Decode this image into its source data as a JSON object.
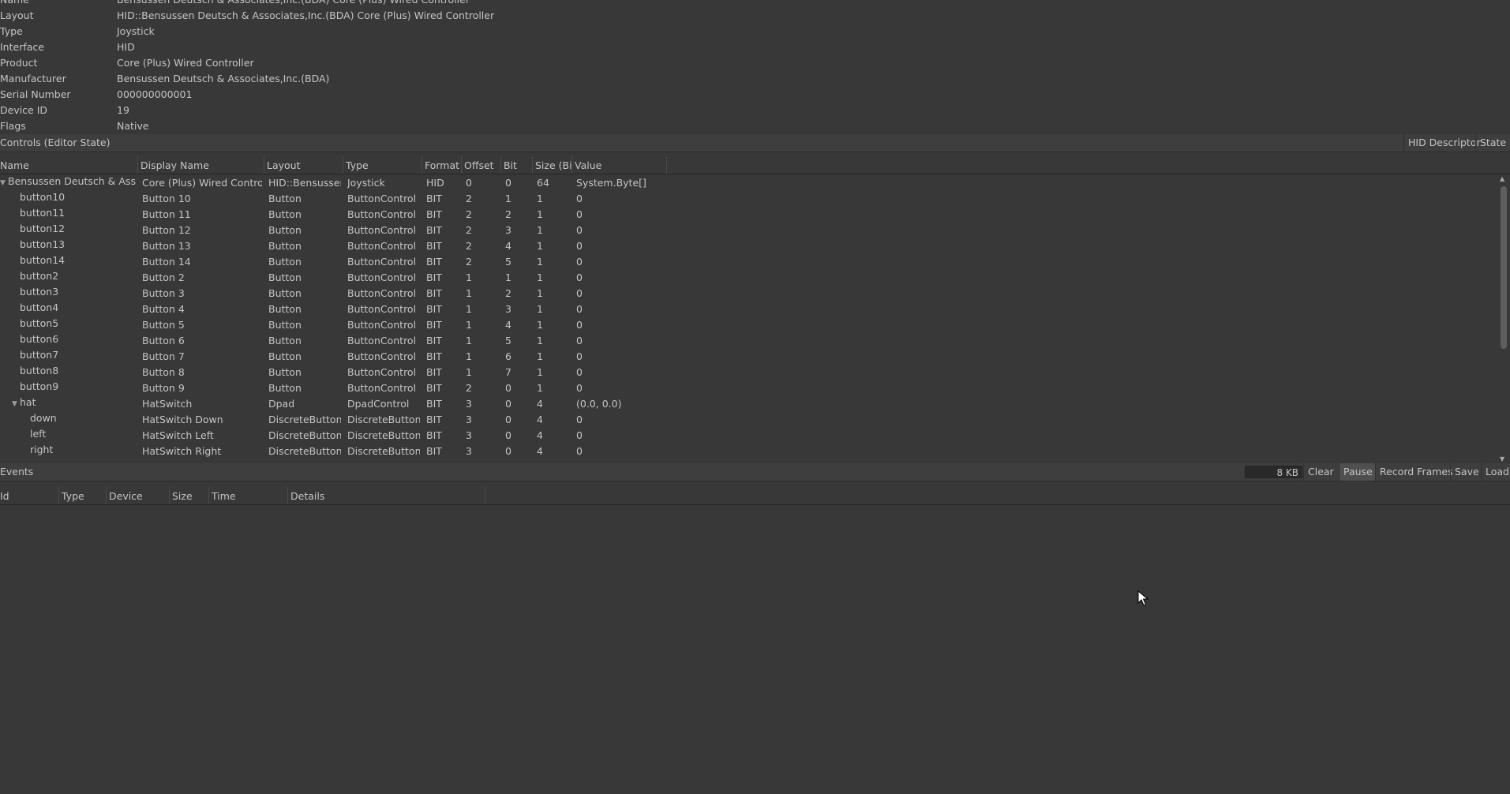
{
  "properties": [
    {
      "key": "Name",
      "value": "Bensussen Deutsch & Associates,Inc.(BDA) Core (Plus) Wired Controller"
    },
    {
      "key": "Layout",
      "value": "HID::Bensussen Deutsch & Associates,Inc.(BDA) Core (Plus) Wired Controller"
    },
    {
      "key": "Type",
      "value": "Joystick"
    },
    {
      "key": "Interface",
      "value": "HID"
    },
    {
      "key": "Product",
      "value": "Core (Plus) Wired Controller"
    },
    {
      "key": "Manufacturer",
      "value": "Bensussen Deutsch & Associates,Inc.(BDA)"
    },
    {
      "key": "Serial Number",
      "value": "000000000001"
    },
    {
      "key": "Device ID",
      "value": "19"
    },
    {
      "key": "Flags",
      "value": "Native"
    }
  ],
  "controls": {
    "title": "Controls (Editor State)",
    "buttons": {
      "hid_descriptor": "HID Descriptor",
      "state": "State"
    },
    "columns": [
      "Name",
      "Display Name",
      "Layout",
      "Type",
      "Format",
      "Offset",
      "Bit",
      "Size (Bi",
      "Value"
    ],
    "rows": [
      {
        "name": "Bensussen Deutsch & Associ",
        "display": "Core (Plus) Wired Controlle",
        "layout": "HID::Bensussen",
        "type": "Joystick",
        "format": "HID",
        "offset": "0",
        "bit": "0",
        "size": "64",
        "value": "System.Byte[]"
      },
      {
        "name": "button10",
        "display": "Button 10",
        "layout": "Button",
        "type": "ButtonControl",
        "format": "BIT",
        "offset": "2",
        "bit": "1",
        "size": "1",
        "value": "0"
      },
      {
        "name": "button11",
        "display": "Button 11",
        "layout": "Button",
        "type": "ButtonControl",
        "format": "BIT",
        "offset": "2",
        "bit": "2",
        "size": "1",
        "value": "0"
      },
      {
        "name": "button12",
        "display": "Button 12",
        "layout": "Button",
        "type": "ButtonControl",
        "format": "BIT",
        "offset": "2",
        "bit": "3",
        "size": "1",
        "value": "0"
      },
      {
        "name": "button13",
        "display": "Button 13",
        "layout": "Button",
        "type": "ButtonControl",
        "format": "BIT",
        "offset": "2",
        "bit": "4",
        "size": "1",
        "value": "0"
      },
      {
        "name": "button14",
        "display": "Button 14",
        "layout": "Button",
        "type": "ButtonControl",
        "format": "BIT",
        "offset": "2",
        "bit": "5",
        "size": "1",
        "value": "0"
      },
      {
        "name": "button2",
        "display": "Button 2",
        "layout": "Button",
        "type": "ButtonControl",
        "format": "BIT",
        "offset": "1",
        "bit": "1",
        "size": "1",
        "value": "0"
      },
      {
        "name": "button3",
        "display": "Button 3",
        "layout": "Button",
        "type": "ButtonControl",
        "format": "BIT",
        "offset": "1",
        "bit": "2",
        "size": "1",
        "value": "0"
      },
      {
        "name": "button4",
        "display": "Button 4",
        "layout": "Button",
        "type": "ButtonControl",
        "format": "BIT",
        "offset": "1",
        "bit": "3",
        "size": "1",
        "value": "0"
      },
      {
        "name": "button5",
        "display": "Button 5",
        "layout": "Button",
        "type": "ButtonControl",
        "format": "BIT",
        "offset": "1",
        "bit": "4",
        "size": "1",
        "value": "0"
      },
      {
        "name": "button6",
        "display": "Button 6",
        "layout": "Button",
        "type": "ButtonControl",
        "format": "BIT",
        "offset": "1",
        "bit": "5",
        "size": "1",
        "value": "0"
      },
      {
        "name": "button7",
        "display": "Button 7",
        "layout": "Button",
        "type": "ButtonControl",
        "format": "BIT",
        "offset": "1",
        "bit": "6",
        "size": "1",
        "value": "0"
      },
      {
        "name": "button8",
        "display": "Button 8",
        "layout": "Button",
        "type": "ButtonControl",
        "format": "BIT",
        "offset": "1",
        "bit": "7",
        "size": "1",
        "value": "0"
      },
      {
        "name": "button9",
        "display": "Button 9",
        "layout": "Button",
        "type": "ButtonControl",
        "format": "BIT",
        "offset": "2",
        "bit": "0",
        "size": "1",
        "value": "0"
      },
      {
        "name": "hat",
        "display": "HatSwitch",
        "layout": "Dpad",
        "type": "DpadControl",
        "format": "BIT",
        "offset": "3",
        "bit": "0",
        "size": "4",
        "value": "(0.0, 0.0)"
      },
      {
        "name": "down",
        "display": "HatSwitch Down",
        "layout": "DiscreteButton",
        "type": "DiscreteButtonC",
        "format": "BIT",
        "offset": "3",
        "bit": "0",
        "size": "4",
        "value": "0"
      },
      {
        "name": "left",
        "display": "HatSwitch Left",
        "layout": "DiscreteButton",
        "type": "DiscreteButtonC",
        "format": "BIT",
        "offset": "3",
        "bit": "0",
        "size": "4",
        "value": "0"
      },
      {
        "name": "right",
        "display": "HatSwitch Right",
        "layout": "DiscreteButton",
        "type": "DiscreteButtonC",
        "format": "BIT",
        "offset": "3",
        "bit": "0",
        "size": "4",
        "value": "0"
      }
    ]
  },
  "events": {
    "title": "Events",
    "buffer_size": "8 KB",
    "buttons": {
      "clear": "Clear",
      "pause": "Pause",
      "record_frames": "Record Frames",
      "save": "Save",
      "load": "Load"
    },
    "columns": [
      "Id",
      "Type",
      "Device",
      "Size",
      "Time",
      "Details"
    ]
  },
  "icons": {
    "expanded": "triangle-down-icon",
    "scroll_up": "scroll-up-icon",
    "scroll_down": "scroll-down-icon",
    "cursor": "mouse-pointer-icon"
  }
}
